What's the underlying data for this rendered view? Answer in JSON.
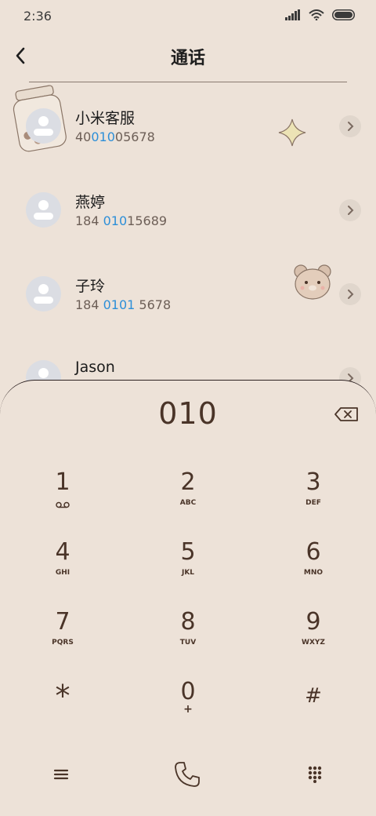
{
  "status_bar": {
    "time": "2:36"
  },
  "header": {
    "title": "通话"
  },
  "contacts": [
    {
      "name": "小米客服",
      "number_pre": "40",
      "number_match": "010",
      "number_post": "05678"
    },
    {
      "name": "燕婷",
      "number_pre": "184 ",
      "number_match": "010",
      "number_post": "15689"
    },
    {
      "name": "子玲",
      "number_pre": "184 ",
      "number_match": "0101",
      "number_post": " 5678"
    },
    {
      "name": "Jason",
      "number_pre": "",
      "number_match": "",
      "number_post": ""
    }
  ],
  "dialer": {
    "digits": "010",
    "keys": [
      {
        "num": "1",
        "sub": ""
      },
      {
        "num": "2",
        "sub": "ABC"
      },
      {
        "num": "3",
        "sub": "DEF"
      },
      {
        "num": "4",
        "sub": "GHI"
      },
      {
        "num": "5",
        "sub": "JKL"
      },
      {
        "num": "6",
        "sub": "MNO"
      },
      {
        "num": "7",
        "sub": "PQRS"
      },
      {
        "num": "8",
        "sub": "TUV"
      },
      {
        "num": "9",
        "sub": "WXYZ"
      },
      {
        "num": "*",
        "sub": ""
      },
      {
        "num": "0",
        "sub": "+"
      },
      {
        "num": "#",
        "sub": ""
      }
    ]
  },
  "colors": {
    "background": "#ede2d8",
    "text": "#4a3428",
    "highlight": "#2d8fd8"
  }
}
